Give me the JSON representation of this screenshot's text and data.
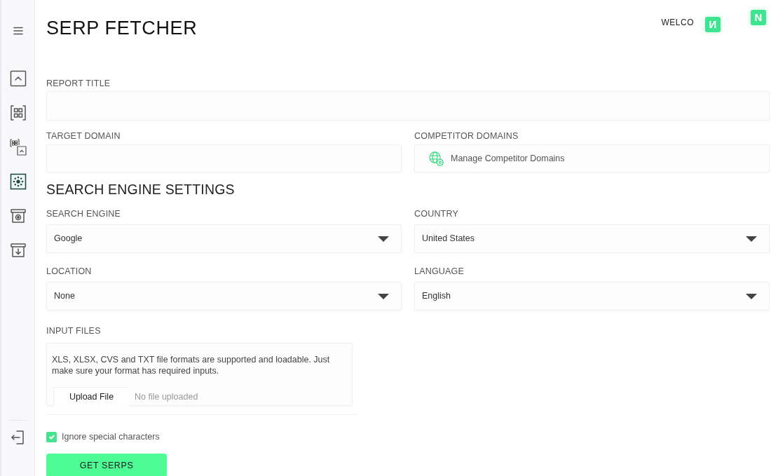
{
  "sidebar": {
    "items": [
      {
        "selected": false
      },
      {
        "selected": false
      },
      {
        "selected": false
      },
      {
        "selected": true
      },
      {
        "selected": false
      },
      {
        "selected": false
      }
    ]
  },
  "header": {
    "title": "SERP FETCHER",
    "welcome": "WELCO",
    "badges": [
      "И",
      "N"
    ]
  },
  "form": {
    "report_title": {
      "label": "REPORT TITLE"
    },
    "target_domain": {
      "label": "TARGET DOMAIN"
    },
    "competitor_domains": {
      "label": "COMPETITOR DOMAINS",
      "button": "Manage Competitor Domains"
    }
  },
  "search_engine_settings": {
    "heading": "SEARCH ENGINE SETTINGS",
    "selects": [
      {
        "label": "SEARCH ENGINE",
        "value": "Google"
      },
      {
        "label": "COUNTRY",
        "value": "United States"
      },
      {
        "label": "LOCATION",
        "value": "None"
      },
      {
        "label": "LANGUAGE",
        "value": "English"
      }
    ]
  },
  "input_files": {
    "label": "INPUT FILES",
    "note": "XLS, XLSX, CVS and TXT file formats are supported and loadable. Just make sure your format has required inputs.",
    "upload_button": "Upload File",
    "status": "No file uploaded"
  },
  "ignore_special_characters": {
    "label": "Ignore special characters",
    "checked": true
  },
  "submit": "GET SERPS"
}
